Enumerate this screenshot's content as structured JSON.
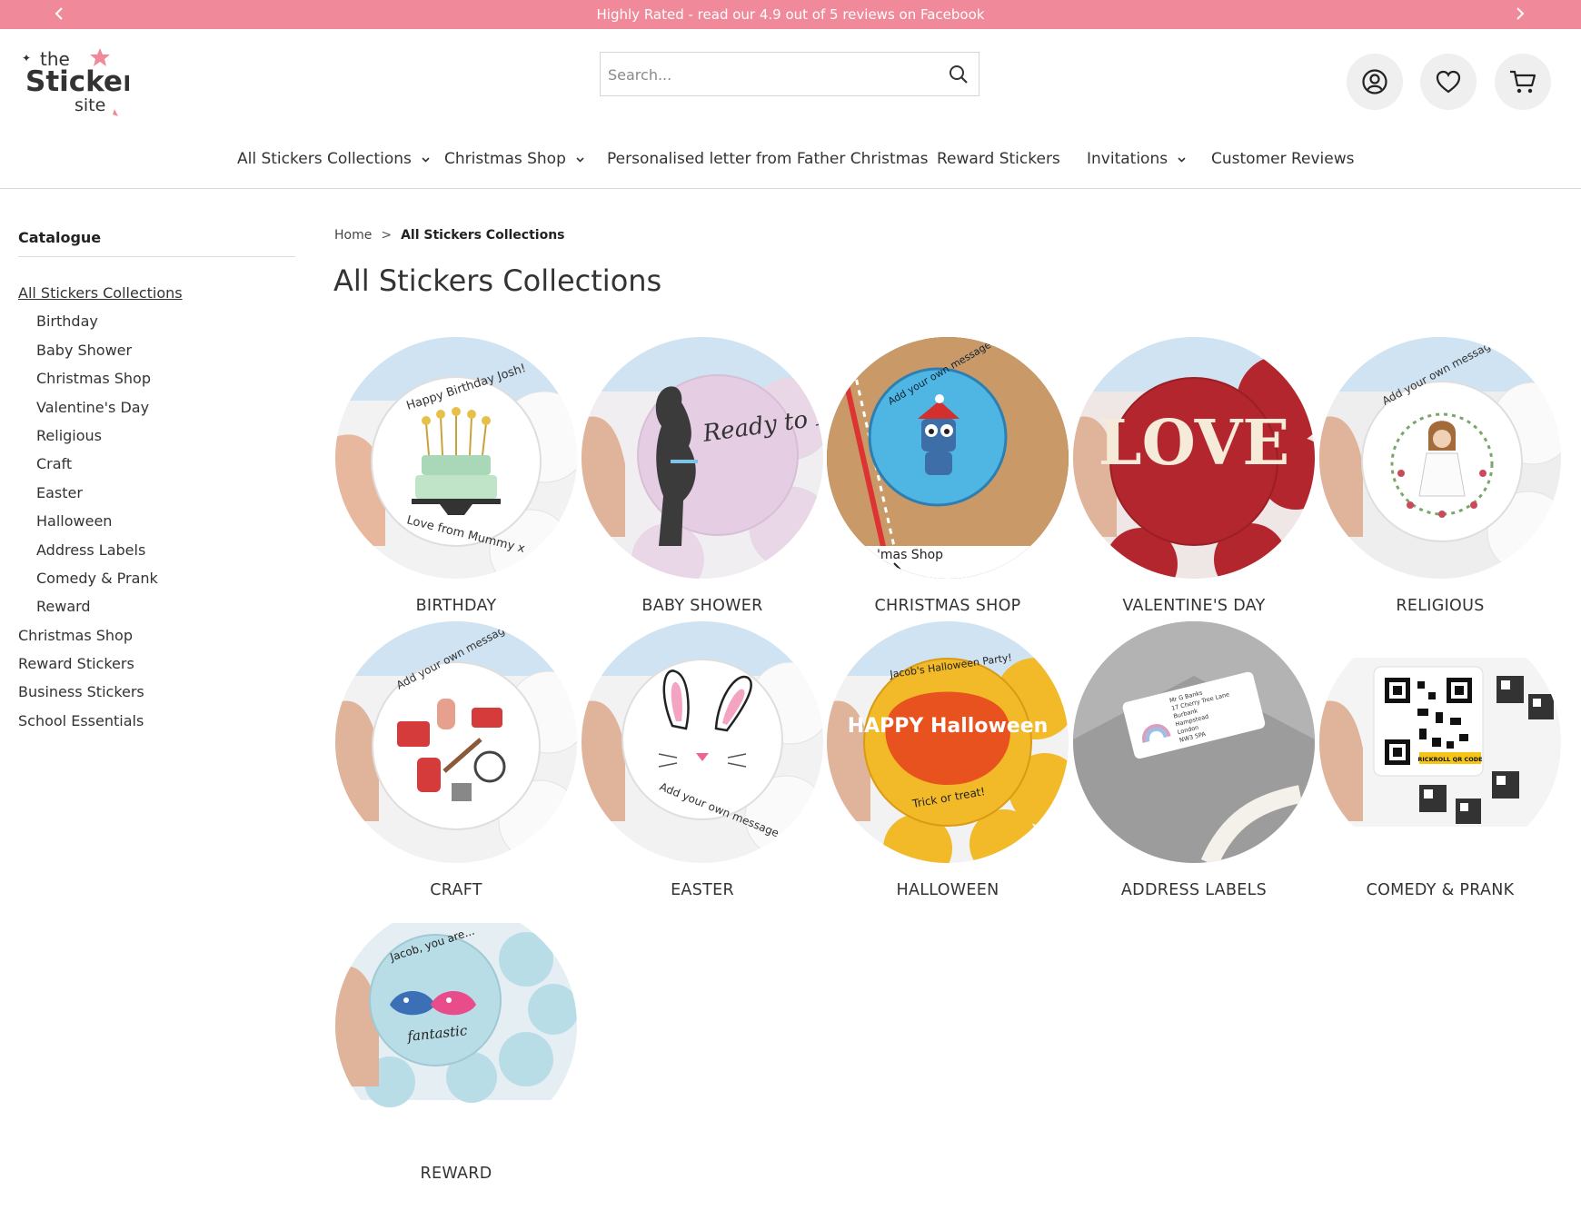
{
  "announcement": {
    "text": "Highly Rated - read our 4.9 out of 5 reviews on Facebook",
    "color": "#f08a9b"
  },
  "logo": {
    "line1": "the",
    "line2": "Sticker",
    "line3": "site",
    "accent": "#f08a9b"
  },
  "search": {
    "placeholder": "Search..."
  },
  "header_icons": [
    "account-icon",
    "heart-icon",
    "cart-icon"
  ],
  "nav": [
    {
      "label": "All Stickers Collections",
      "dropdown": true
    },
    {
      "label": "Christmas Shop",
      "dropdown": true
    },
    {
      "label": "Personalised letter from Father Christmas",
      "dropdown": false
    },
    {
      "label": "Reward Stickers",
      "dropdown": false
    },
    {
      "label": "Invitations",
      "dropdown": true
    },
    {
      "label": "Customer Reviews",
      "dropdown": false
    }
  ],
  "sidebar": {
    "title": "Catalogue",
    "items": [
      {
        "label": "All Stickers Collections",
        "level": 0,
        "current": true
      },
      {
        "label": "Birthday",
        "level": 1
      },
      {
        "label": "Baby Shower",
        "level": 1
      },
      {
        "label": "Christmas Shop",
        "level": 1
      },
      {
        "label": "Valentine's Day",
        "level": 1
      },
      {
        "label": "Religious",
        "level": 1
      },
      {
        "label": "Craft",
        "level": 1
      },
      {
        "label": "Easter",
        "level": 1
      },
      {
        "label": "Halloween",
        "level": 1
      },
      {
        "label": "Address Labels",
        "level": 1
      },
      {
        "label": "Comedy & Prank",
        "level": 1
      },
      {
        "label": "Reward",
        "level": 1
      },
      {
        "label": "Christmas Shop",
        "level": 0
      },
      {
        "label": "Reward Stickers",
        "level": 0
      },
      {
        "label": "Business Stickers",
        "level": 0
      },
      {
        "label": "School Essentials",
        "level": 0
      }
    ]
  },
  "breadcrumb": {
    "home": "Home",
    "separator": ">",
    "current": "All Stickers Collections"
  },
  "page_title": "All Stickers Collections",
  "categories": [
    {
      "label": "BIRTHDAY",
      "image": {
        "sticker_top": "Happy Birthday Josh!",
        "sticker_bottom": "Love from Mummy x"
      }
    },
    {
      "label": "BABY SHOWER",
      "image": {
        "sticker_text": "Ready to POP!"
      }
    },
    {
      "label": "CHRISTMAS SHOP",
      "image": {
        "sticker_text": "Add your own message",
        "overlay_link": "'mas Shop"
      }
    },
    {
      "label": "VALENTINE'S DAY",
      "image": {
        "sticker_text": "LOVE"
      }
    },
    {
      "label": "RELIGIOUS",
      "image": {
        "sticker_text": "Add your own message"
      }
    },
    {
      "label": "CRAFT",
      "image": {
        "sticker_text": "Add your own message"
      }
    },
    {
      "label": "EASTER",
      "image": {
        "sticker_text": "Add your own message"
      }
    },
    {
      "label": "HALLOWEEN",
      "image": {
        "sticker_top": "Jacob's Halloween Party!",
        "sticker_middle": "HAPPY Halloween",
        "sticker_bottom": "Trick or treat!"
      }
    },
    {
      "label": "ADDRESS LABELS",
      "image": {
        "lines": [
          "Mr G Banks",
          "17 Cherry Tree Lane",
          "Burbank",
          "Hampstead",
          "London",
          "NW3 5PA"
        ]
      }
    },
    {
      "label": "COMEDY & PRANK",
      "image": {
        "badge": "RICKROLL QR CODE"
      }
    },
    {
      "label": "REWARD",
      "image": {
        "sticker_top": "Jacob, you are...",
        "sticker_bottom": "fantastic"
      }
    }
  ]
}
